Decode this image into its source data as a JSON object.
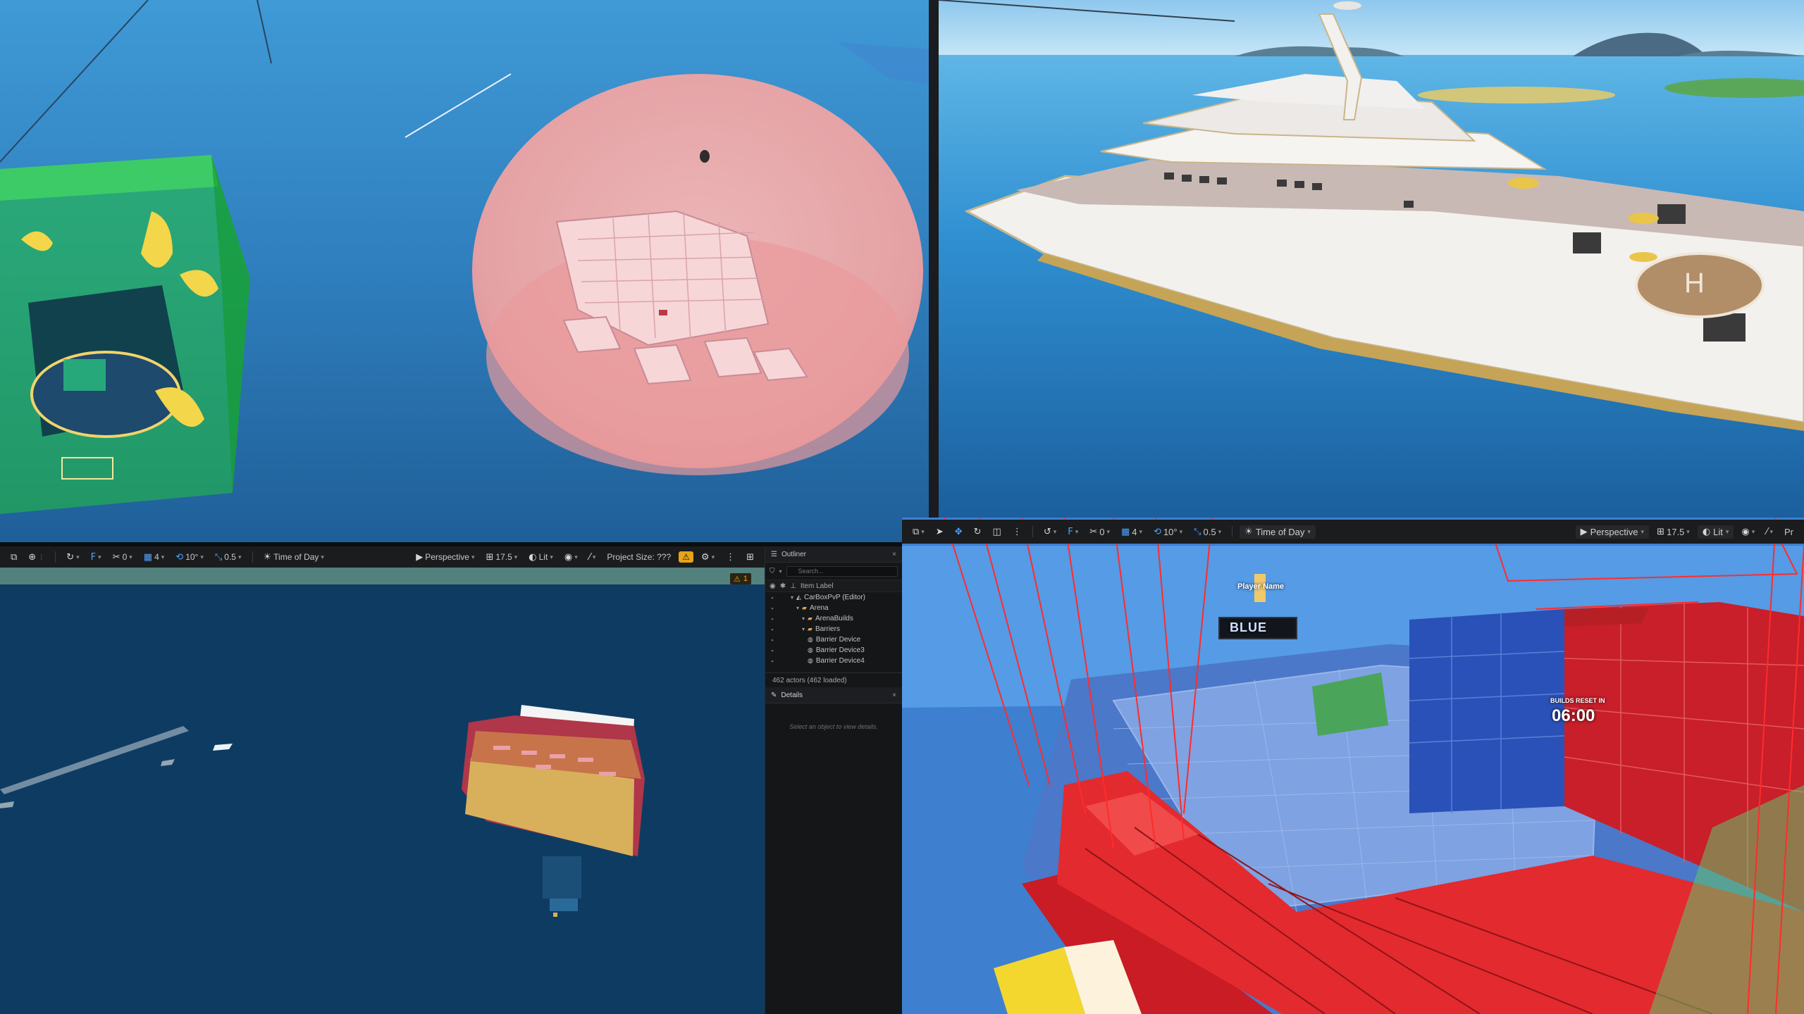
{
  "top_left": {},
  "top_right": {},
  "bottom_left": {
    "toolbar": {
      "snap_angle": "0",
      "grid_size": "4",
      "rotation_snap": "10°",
      "scale_snap": "0.5",
      "time_of_day": "Time of Day",
      "view_mode": "Perspective",
      "fov": "17.5",
      "lighting": "Lit",
      "project_size": "Project Size: ???",
      "warning_count": "1"
    },
    "outliner": {
      "tab_label": "Outliner",
      "search_placeholder": "Search...",
      "column_label": "Item Label",
      "rows": [
        {
          "label": "CarBoxPvP (Editor)",
          "indent": 1,
          "kind": "level"
        },
        {
          "label": "Arena",
          "indent": 2,
          "kind": "folder"
        },
        {
          "label": "ArenaBuilds",
          "indent": 3,
          "kind": "folder"
        },
        {
          "label": "Barriers",
          "indent": 3,
          "kind": "folder"
        },
        {
          "label": "Barrier Device",
          "indent": 4,
          "kind": "actor"
        },
        {
          "label": "Barrier Device3",
          "indent": 4,
          "kind": "actor"
        },
        {
          "label": "Barrier Device4",
          "indent": 4,
          "kind": "actor"
        }
      ],
      "status": "462 actors (462 loaded)"
    },
    "details": {
      "tab_label": "Details",
      "hint": "Select an object to view details."
    }
  },
  "bottom_right": {
    "toolbar": {
      "snap_angle": "0",
      "grid_size": "4",
      "rotation_snap": "10°",
      "scale_snap": "0.5",
      "time_of_day": "Time of Day",
      "view_mode": "Perspective",
      "fov": "17.5",
      "lighting": "Lit",
      "overflow": "Pr"
    },
    "overlay": {
      "player_name": "Player Name",
      "sign_text": "BLUE",
      "timer_caption": "BUILDS RESET IN",
      "timer": "06:00"
    }
  },
  "colors": {
    "ocean": "#2e7fbf",
    "deep_ocean": "#0e3a5e",
    "sphere": "#f0a7a7",
    "green_volume": "#1fbf3a",
    "red_barrier": "#e52424",
    "blue_arena": "#3d67c9",
    "toolbar_bg": "#1b1c1e"
  }
}
